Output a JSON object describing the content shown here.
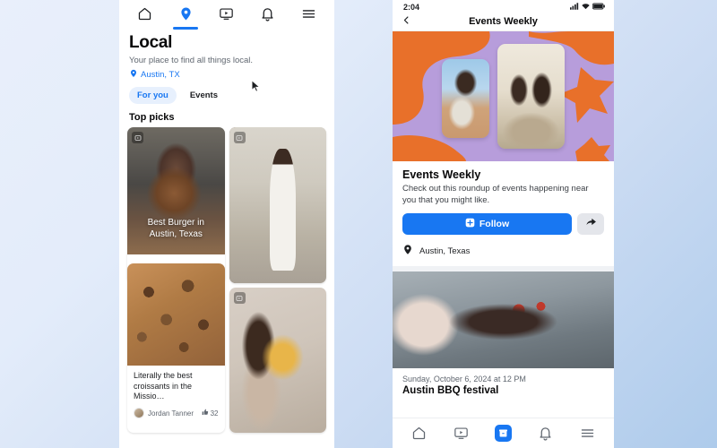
{
  "background": {
    "from": "#e9effb",
    "to": "#aecbeb"
  },
  "accent": "#1877f2",
  "left_phone": {
    "top_nav": [
      {
        "name": "home-icon",
        "label": "Home",
        "active": false
      },
      {
        "name": "location-pin-icon",
        "label": "Local",
        "active": true
      },
      {
        "name": "video-icon",
        "label": "Video",
        "active": false
      },
      {
        "name": "bell-icon",
        "label": "Notifications",
        "active": false
      },
      {
        "name": "menu-icon",
        "label": "Menu",
        "active": false
      }
    ],
    "title": "Local",
    "subtitle": "Your place to find all things local.",
    "location": "Austin, TX",
    "tabs": [
      {
        "label": "For you",
        "active": true
      },
      {
        "label": "Events",
        "active": false
      }
    ],
    "section_title": "Top picks",
    "cards": [
      {
        "name": "card-best-burger",
        "overlay_text": "Best Burger in Austin, Texas",
        "has_reel_badge": true,
        "media": "img-burger"
      },
      {
        "name": "card-white-dress",
        "overlay_text": "",
        "has_reel_badge": true,
        "media": "img-dress"
      },
      {
        "name": "card-croissants",
        "caption": "Literally the best croissants in the Missio…",
        "author": "Jordan Tanner",
        "likes": "32",
        "has_reel_badge": false,
        "media": "img-pastry"
      },
      {
        "name": "card-grilled-cheese",
        "overlay_text": "",
        "has_reel_badge": true,
        "media": "img-toast"
      }
    ]
  },
  "right_phone": {
    "status_bar": {
      "time": "2:04",
      "signal": "signal-icon",
      "wifi": "wifi-icon",
      "battery": "battery-icon"
    },
    "header": {
      "back": "back-chevron-icon",
      "title": "Events Weekly"
    },
    "banner": {
      "bg_color": "#b79ddb",
      "shape_color": "#e8702a",
      "photos": [
        "photo-friends-peace-sign",
        "photo-pottery-class"
      ]
    },
    "detail": {
      "title": "Events Weekly",
      "description": "Check out this roundup of events happening near you that you might like.",
      "follow_label": "Follow",
      "follow_icon": "follow-plus-icon",
      "share_icon": "share-arrow-icon",
      "location_icon": "location-pin-icon",
      "location": "Austin, Texas"
    },
    "event": {
      "image": "photo-bbq-platter",
      "date": "Sunday, October 6, 2024 at 12 PM",
      "name": "Austin BBQ festival"
    },
    "bottom_nav": [
      {
        "name": "home-icon",
        "label": "Home",
        "active": false
      },
      {
        "name": "video-icon",
        "label": "Video",
        "active": false
      },
      {
        "name": "marketplace-icon",
        "label": "Marketplace",
        "active": true
      },
      {
        "name": "bell-icon",
        "label": "Notifications",
        "active": false
      },
      {
        "name": "menu-icon",
        "label": "Menu",
        "active": false
      }
    ]
  }
}
